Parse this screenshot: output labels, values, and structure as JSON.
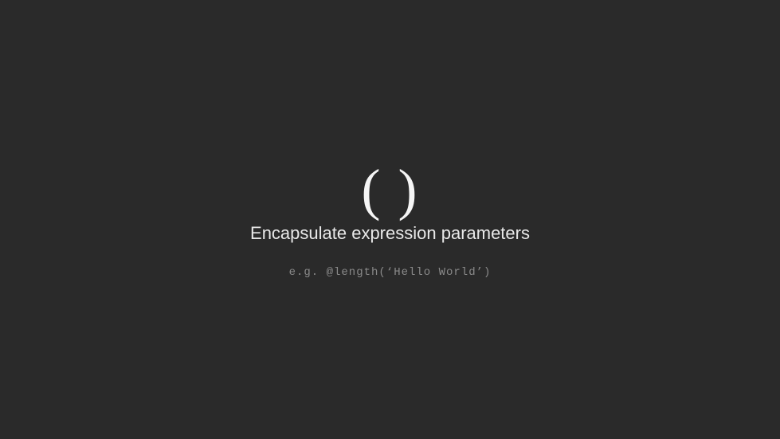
{
  "slide": {
    "symbol": "( )",
    "subtitle": "Encapsulate expression parameters",
    "example": "e.g. @length(‘Hello World’)"
  }
}
